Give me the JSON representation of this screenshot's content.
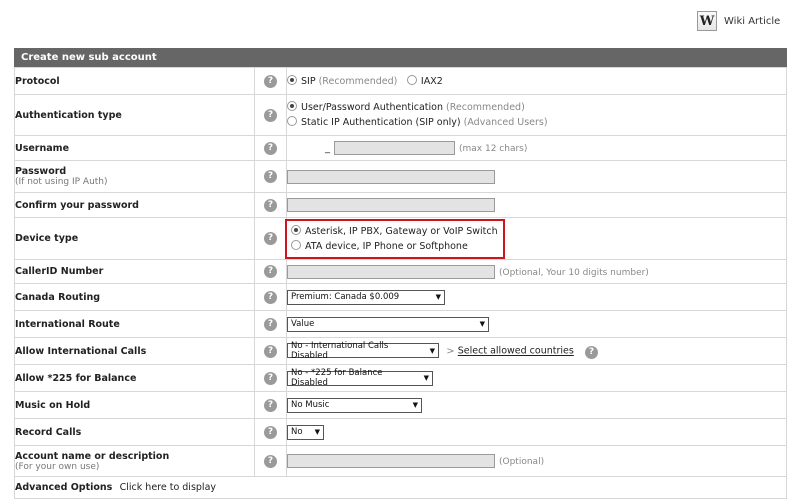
{
  "wiki": {
    "label": "Wiki Article",
    "logo": "W"
  },
  "panel": {
    "title": "Create new sub account"
  },
  "protocol": {
    "label": "Protocol",
    "sip": "SIP",
    "sip_note": "(Recommended)",
    "iax": "IAX2",
    "selected": "SIP"
  },
  "auth": {
    "label": "Authentication type",
    "opt1": "User/Password Authentication",
    "opt1_note": "(Recommended)",
    "opt2": "Static IP Authentication (SIP only)",
    "opt2_note": "(Advanced Users)",
    "selected": "opt1"
  },
  "username": {
    "label": "Username",
    "prefix": "_",
    "value": "",
    "hint": "(max 12 chars)"
  },
  "password": {
    "label": "Password",
    "sub": "(If not using IP Auth)",
    "value": ""
  },
  "confirm": {
    "label": "Confirm your password",
    "value": ""
  },
  "device": {
    "label": "Device type",
    "opt1": "Asterisk, IP PBX, Gateway or VoIP Switch",
    "opt2": "ATA device, IP Phone or Softphone",
    "selected": "opt1",
    "highlight_color": "#d0141e"
  },
  "callerid": {
    "label": "CallerID Number",
    "value": "",
    "hint": "(Optional, Your 10 digits number)"
  },
  "canada": {
    "label": "Canada Routing",
    "value": "Premium: Canada $0.009"
  },
  "intl_route": {
    "label": "International Route",
    "value": "Value"
  },
  "allow_intl": {
    "label": "Allow International Calls",
    "value": "No - International Calls Disabled",
    "link": "Select allowed countries",
    "link_prefix": ">"
  },
  "balance": {
    "label": "Allow *225 for Balance",
    "value": "No - *225 for Balance Disabled"
  },
  "moh": {
    "label": "Music on Hold",
    "value": "No Music"
  },
  "record": {
    "label": "Record Calls",
    "value": "No"
  },
  "account_desc": {
    "label": "Account name or description",
    "sub": "(For your own use)",
    "value": "",
    "hint": "(Optional)"
  },
  "advanced": {
    "label": "Advanced Options",
    "link": "Click here to display"
  },
  "help_glyph": "?",
  "caret_glyph": "▼",
  "colors": {
    "header_bg": "#666666",
    "border": "#d7d7d7",
    "input_bg": "#e3e3e3"
  }
}
